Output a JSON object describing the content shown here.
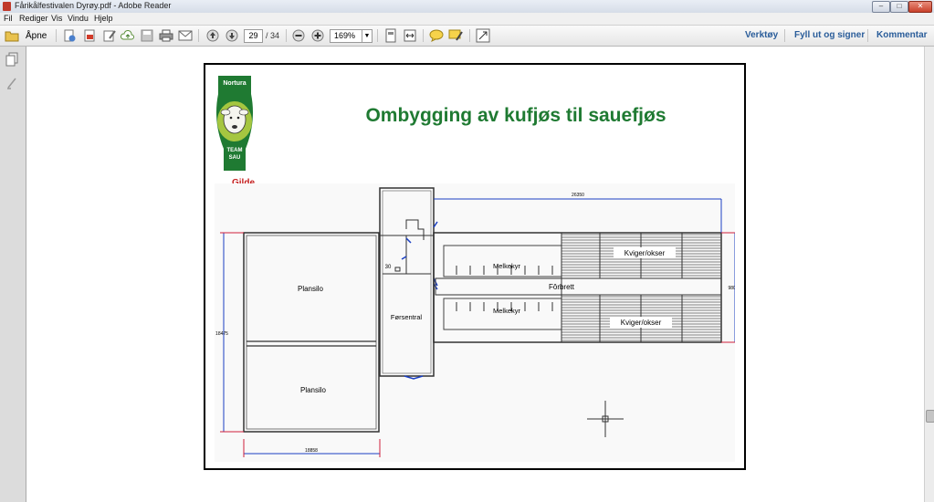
{
  "window": {
    "title": "Fårikålfestivalen Dyrøy.pdf - Adobe Reader",
    "buttons": {
      "minimize": "–",
      "maximize": "□",
      "close": "✕"
    }
  },
  "menu": [
    "Fil",
    "Rediger",
    "Vis",
    "Vindu",
    "Hjelp"
  ],
  "toolbar": {
    "open_label": "Åpne",
    "current_page": "29",
    "total_pages": "/ 34",
    "zoom": "169%",
    "right": {
      "tools": "Verktøy",
      "sign": "Fyll ut og signer",
      "comment": "Kommentar"
    }
  },
  "icons": [
    "folder-icon",
    "create-pdf-icon",
    "pdf-icon",
    "edit-icon",
    "cloud-icon",
    "save-icon",
    "print-icon",
    "email-icon",
    "page-up-icon",
    "page-down-icon",
    "zoom-out-icon",
    "zoom-in-icon",
    "fit-page-icon",
    "fit-width-icon",
    "comment-icon",
    "highlight-icon",
    "fullscreen-icon",
    "pages-panel-icon",
    "signature-panel-icon"
  ],
  "slide": {
    "title": "Ombygging av kufjøs til sauefjøs",
    "logo": {
      "brand": "Nortura",
      "team": "TEAM",
      "sau": "SAU"
    },
    "gilde": "Gilde"
  },
  "plan": {
    "dim_top": "26350",
    "dim_right": "9800",
    "dim_left": "18475",
    "dim_bottom": "18858",
    "silo1": "Plansilo",
    "silo2": "Plansilo",
    "forsentral": "Førsentral",
    "melkekyr1": "Melkekyr",
    "melkekyr2": "Melkekyr",
    "forbrett": "Fôrbrett",
    "kviger1": "Kviger/okser",
    "kviger2": "Kviger/okser",
    "small_label": "30"
  },
  "colors": {
    "title_green": "#1f7a32",
    "dim_blue": "#1a3fc4",
    "dim_red": "#d0203a",
    "link_blue": "#2a5d9a"
  }
}
